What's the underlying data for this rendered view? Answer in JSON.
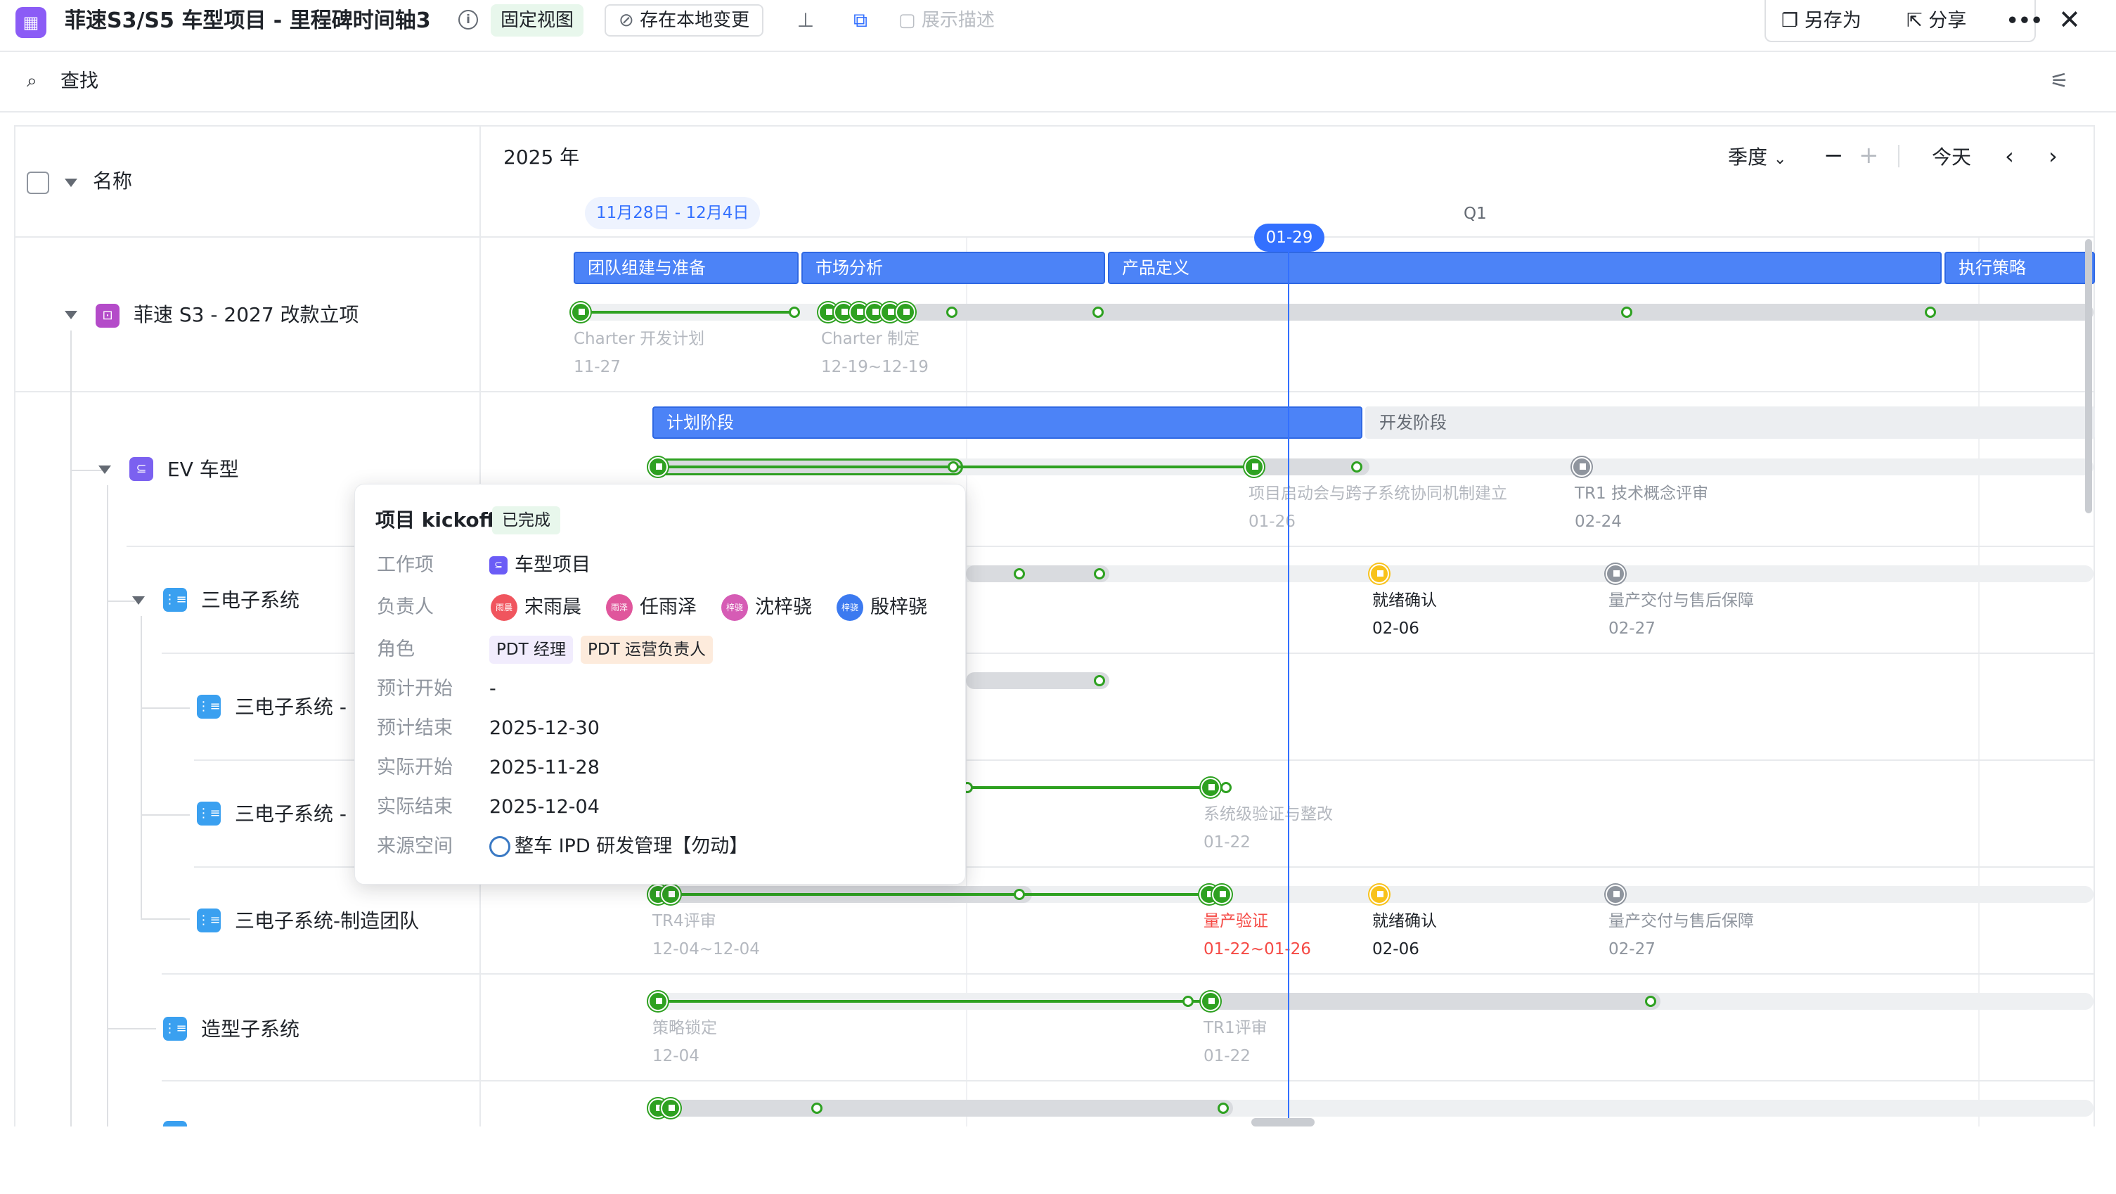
{
  "window": {
    "title": "菲速S3/S5 车型项目 - 里程碑时间轴3",
    "fixed_view_label": "固定视图",
    "save_local_label": "存在本地变更",
    "show_desc_label": "展示描述",
    "save_as_label": "另存为",
    "share_label": "分享"
  },
  "search": {
    "label": "查找"
  },
  "header": {
    "name_col": "名称",
    "year": "2025 年",
    "range": "11月28日 - 12月4日",
    "quarter": "Q1",
    "granularity": "季度",
    "today_btn": "今天",
    "today_marker": "01-29"
  },
  "tree": [
    {
      "label": "菲速 S3 - 2027 改款立项",
      "type": "project"
    },
    {
      "label": "EV 车型",
      "type": "vehicle"
    },
    {
      "label": "三电子系统",
      "type": "system"
    },
    {
      "label": "三电子系统 -",
      "type": "system"
    },
    {
      "label": "三电子系统 -",
      "type": "system"
    },
    {
      "label": "三电子系统-制造团队",
      "type": "system"
    },
    {
      "label": "造型子系统",
      "type": "system"
    }
  ],
  "phases": {
    "row0": [
      "团队组建与准备",
      "市场分析",
      "产品定义",
      "执行策略"
    ],
    "row1": [
      "计划阶段",
      "开发阶段"
    ]
  },
  "milestones": {
    "r0_a": {
      "name": "Charter 开发计划",
      "date": "11-27"
    },
    "r0_b": {
      "name": "Charter 制定",
      "date": "12-19~12-19"
    },
    "r1_a": {
      "name": "项目启动会与跨子系统协同机制建立",
      "date": "01-26"
    },
    "r1_b": {
      "name": "TR1 技术概念评审",
      "date": "02-24"
    },
    "r2_a": {
      "name": "就绪确认",
      "date": "02-06"
    },
    "r2_b": {
      "name": "量产交付与售后保障",
      "date": "02-27"
    },
    "r4_a": {
      "name": "系统级验证与整改",
      "date": "01-22"
    },
    "r5_a": {
      "name": "TR4评审",
      "date": "12-04~12-04"
    },
    "r5_b": {
      "name": "量产验证",
      "date": "01-22~01-26"
    },
    "r5_c": {
      "name": "就绪确认",
      "date": "02-06"
    },
    "r5_d": {
      "name": "量产交付与售后保障",
      "date": "02-27"
    },
    "r6_a": {
      "name": "策略锁定",
      "date": "12-04"
    },
    "r6_b": {
      "name": "TR1评审",
      "date": "01-22"
    }
  },
  "popover": {
    "title": "项目 kickoff",
    "status": "已完成",
    "fields": {
      "work_item_key": "工作项",
      "work_item_val": "车型项目",
      "owner_key": "负责人",
      "role_key": "角色",
      "plan_start_key": "预计开始",
      "plan_start_val": "-",
      "plan_end_key": "预计结束",
      "plan_end_val": "2025-12-30",
      "actual_start_key": "实际开始",
      "actual_start_val": "2025-11-28",
      "actual_end_key": "实际结束",
      "actual_end_val": "2025-12-04",
      "source_key": "来源空间",
      "source_val": "整车 IPD 研发管理【勿动】"
    },
    "owners": [
      {
        "name": "宋雨晨",
        "initials": "雨晨",
        "color": "#f0555e"
      },
      {
        "name": "任雨泽",
        "initials": "雨泽",
        "color": "#e0569c"
      },
      {
        "name": "沈梓骁",
        "initials": "梓骁",
        "color": "#d65cb5"
      },
      {
        "name": "殷梓骁",
        "initials": "梓骁",
        "color": "#3c7af0"
      }
    ],
    "roles": [
      "PDT 经理",
      "PDT 运营负责人"
    ]
  },
  "colors": {
    "accent": "#3370ff",
    "phase_blue": "#4c83f7",
    "done_green": "#2ea121",
    "warn_yellow": "#f8c21b",
    "pending_grey": "#8f959e"
  }
}
